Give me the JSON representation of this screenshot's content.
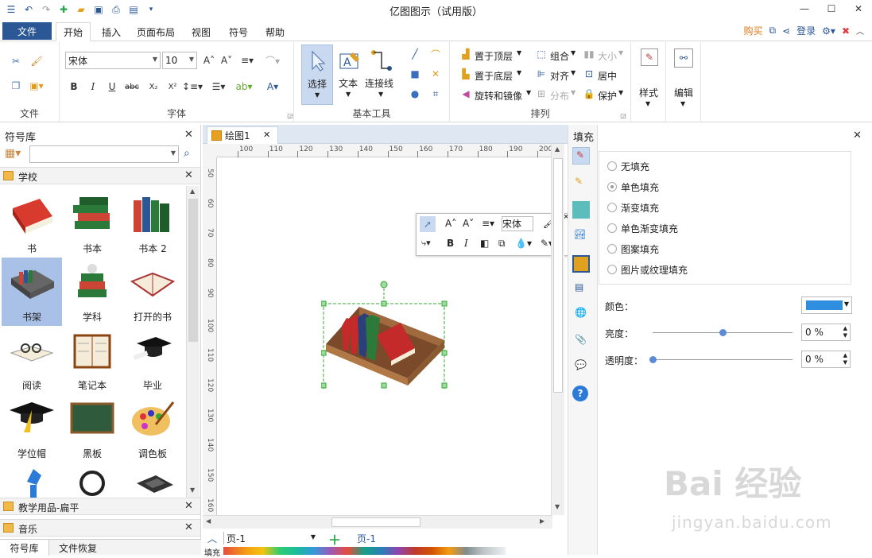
{
  "app": {
    "title": "亿图图示（试用版）"
  },
  "menu": {
    "tabs": [
      "文件",
      "开始",
      "插入",
      "页面布局",
      "视图",
      "符号",
      "帮助"
    ],
    "buy": "购买",
    "login": "登录"
  },
  "ribbon": {
    "file_group": {
      "label": "文件"
    },
    "font_group": {
      "label": "字体",
      "font_name": "宋体",
      "font_size": "10"
    },
    "tools_group": {
      "label": "基本工具",
      "select": "选择",
      "text": "文本",
      "connector": "连接线"
    },
    "arrange_group": {
      "label": "排列",
      "bring_front": "置于顶层",
      "send_back": "置于底层",
      "rotate_mirror": "旋转和镜像",
      "group": "组合",
      "align": "对齐",
      "distribute": "分布",
      "size": "大小",
      "center": "居中",
      "protect": "保护"
    },
    "style_label": "样式",
    "edit_label": "编辑"
  },
  "library": {
    "title": "符号库",
    "search_placeholder": "",
    "categories": [
      {
        "name": "学校"
      },
      {
        "name": "教学用品-扁平"
      },
      {
        "name": "音乐"
      }
    ],
    "symbols": [
      {
        "label": "书"
      },
      {
        "label": "书本"
      },
      {
        "label": "书本 2"
      },
      {
        "label": "书架"
      },
      {
        "label": "学科"
      },
      {
        "label": "打开的书"
      },
      {
        "label": "阅读"
      },
      {
        "label": "笔记本"
      },
      {
        "label": "毕业"
      },
      {
        "label": "学位帽"
      },
      {
        "label": "黑板"
      },
      {
        "label": "调色板"
      }
    ],
    "bottom_tabs": [
      "符号库",
      "文件恢复"
    ]
  },
  "document": {
    "tab": "绘图1",
    "ruler_h": [
      "100",
      "110",
      "120",
      "130",
      "140",
      "150",
      "160",
      "170",
      "180",
      "190",
      "200"
    ],
    "ruler_v": [
      "50",
      "60",
      "70",
      "80",
      "90",
      "100",
      "110",
      "120",
      "130",
      "140",
      "150",
      "160"
    ],
    "page_selector": "页-1",
    "page_tab": "页-1",
    "fill_label": "填充"
  },
  "floating_toolbar": {
    "font": "宋体"
  },
  "fill_panel": {
    "title": "填充",
    "options": [
      {
        "label": "无填充",
        "checked": false
      },
      {
        "label": "单色填充",
        "checked": true
      },
      {
        "label": "渐变填充",
        "checked": false
      },
      {
        "label": "单色渐变填充",
        "checked": false
      },
      {
        "label": "图案填充",
        "checked": false
      },
      {
        "label": "图片或纹理填充",
        "checked": false
      }
    ],
    "color_label": "颜色：",
    "color_value": "#2f8fde",
    "brightness_label": "亮度：",
    "brightness_value": "0 %",
    "brightness_level": 0.5,
    "transparency_label": "透明度：",
    "transparency_value": "0 %",
    "transparency_level": 0
  },
  "watermark": {
    "logo": "Bai 经验",
    "url": "jingyan.baidu.com"
  }
}
